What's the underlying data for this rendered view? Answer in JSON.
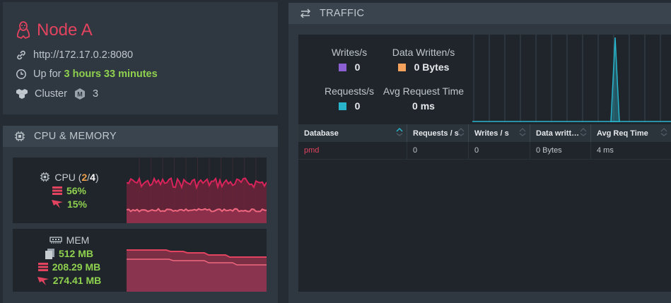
{
  "node": {
    "name": "Node A",
    "url": "http://172.17.0.2:8080",
    "uptime_prefix": "Up for",
    "uptime_value": "3 hours 33 minutes",
    "cluster_label": "Cluster",
    "cluster_count": "3"
  },
  "cpu_memory": {
    "title": "CPU & MEMORY",
    "cpu": {
      "label": "CPU (",
      "used": "2",
      "sep": "/",
      "total": "4",
      "close": ")",
      "stack_pct": "56%",
      "process_pct": "15%",
      "stack_level": 0.56,
      "process_level": 0.15
    },
    "mem": {
      "label": "MEM",
      "total": "512 MB",
      "used": "208.29 MB",
      "process": "274.41 MB"
    }
  },
  "traffic": {
    "title": "TRAFFIC",
    "stats": {
      "writes_label": "Writes/s",
      "writes_value": "0",
      "data_written_label": "Data Written/s",
      "data_written_value": "0 Bytes",
      "requests_label": "Requests/s",
      "requests_value": "0",
      "avg_time_label": "Avg Request Time",
      "avg_time_value": "0 ms"
    },
    "table": {
      "headers": [
        "Database",
        "Requests / s",
        "Writes / s",
        "Data writt…",
        "Avg Req Time"
      ],
      "rows": [
        [
          "pmd",
          "0",
          "0",
          "0 Bytes",
          "4 ms"
        ]
      ]
    }
  },
  "colors": {
    "accent": "#e2435f",
    "green": "#8fd14f",
    "orange": "#f0a04b",
    "writes": "#8c5fd3",
    "data_written": "#f5a25d",
    "requests": "#28b5cc"
  }
}
